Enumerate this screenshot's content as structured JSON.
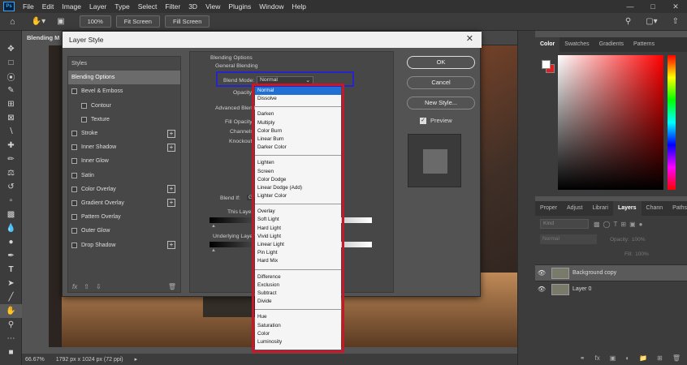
{
  "menubar": {
    "logo": "Ps",
    "items": [
      "File",
      "Edit",
      "Image",
      "Layer",
      "Type",
      "Select",
      "Filter",
      "3D",
      "View",
      "Plugins",
      "Window",
      "Help"
    ]
  },
  "options_bar": {
    "zoom": "100%",
    "fit": "Fit Screen",
    "fill": "Fill Screen"
  },
  "document_tab": "Blending M",
  "status": {
    "zoom": "66.67%",
    "size": "1792 px x 1024 px (72 ppi)"
  },
  "color_panel": {
    "tabs": [
      "Color",
      "Swatches",
      "Gradients",
      "Patterns"
    ]
  },
  "layers_panel": {
    "tabs": [
      "Proper",
      "Adjust",
      "Librari",
      "Layers",
      "Chann",
      "Paths"
    ],
    "kind_placeholder": "Kind",
    "blend": "Normal",
    "opacity_label": "Opacity:",
    "opacity_value": "100%",
    "fill_label": "Fill:",
    "fill_value": "100%",
    "layers": [
      "Background copy",
      "Layer 0"
    ]
  },
  "dialog": {
    "title": "Layer Style",
    "styles_header": "Styles",
    "styles": [
      {
        "label": "Blending Options",
        "checkbox": false,
        "plus": false,
        "selected": true,
        "indent": false
      },
      {
        "label": "Bevel & Emboss",
        "checkbox": true,
        "plus": false,
        "selected": false,
        "indent": false
      },
      {
        "label": "Contour",
        "checkbox": true,
        "plus": false,
        "selected": false,
        "indent": true
      },
      {
        "label": "Texture",
        "checkbox": true,
        "plus": false,
        "selected": false,
        "indent": true
      },
      {
        "label": "Stroke",
        "checkbox": true,
        "plus": true,
        "selected": false,
        "indent": false
      },
      {
        "label": "Inner Shadow",
        "checkbox": true,
        "plus": true,
        "selected": false,
        "indent": false
      },
      {
        "label": "Inner Glow",
        "checkbox": true,
        "plus": false,
        "selected": false,
        "indent": false
      },
      {
        "label": "Satin",
        "checkbox": true,
        "plus": false,
        "selected": false,
        "indent": false
      },
      {
        "label": "Color Overlay",
        "checkbox": true,
        "plus": true,
        "selected": false,
        "indent": false
      },
      {
        "label": "Gradient Overlay",
        "checkbox": true,
        "plus": true,
        "selected": false,
        "indent": false
      },
      {
        "label": "Pattern Overlay",
        "checkbox": true,
        "plus": false,
        "selected": false,
        "indent": false
      },
      {
        "label": "Outer Glow",
        "checkbox": true,
        "plus": false,
        "selected": false,
        "indent": false
      },
      {
        "label": "Drop Shadow",
        "checkbox": true,
        "plus": true,
        "selected": false,
        "indent": false
      }
    ],
    "footer_fx": "fx",
    "blending_options": "Blending Options",
    "general_blending": "General Blending",
    "blend_mode_label": "Blend Mode:",
    "blend_mode_value": "Normal",
    "opacity_label": "Opacity:",
    "advanced_blending": "Advanced Blend",
    "fill_opacity_label": "Fill Opacity:",
    "channels_label": "Channels:",
    "knockout_label": "Knockout:",
    "blend_if_label": "Blend If:",
    "blend_if_value": "Gr",
    "this_layer_label": "This Layer",
    "underlying_layer_label": "Underlying Layer",
    "buttons": {
      "ok": "OK",
      "cancel": "Cancel",
      "new_style": "New Style..."
    },
    "preview_label": "Preview",
    "blend_modes": [
      [
        "Normal",
        "Dissolve"
      ],
      [
        "Darken",
        "Multiply",
        "Color Burn",
        "Linear Burn",
        "Darker Color"
      ],
      [
        "Lighten",
        "Screen",
        "Color Dodge",
        "Linear Dodge (Add)",
        "Lighter Color"
      ],
      [
        "Overlay",
        "Soft Light",
        "Hard Light",
        "Vivid Light",
        "Linear Light",
        "Pin Light",
        "Hard Mix"
      ],
      [
        "Difference",
        "Exclusion",
        "Subtract",
        "Divide"
      ],
      [
        "Hue",
        "Saturation",
        "Color",
        "Luminosity"
      ]
    ]
  },
  "colors": {
    "highlight_blue": "#2525c8",
    "highlight_red": "#c8172a",
    "selected_item": "#1f6fd4"
  }
}
